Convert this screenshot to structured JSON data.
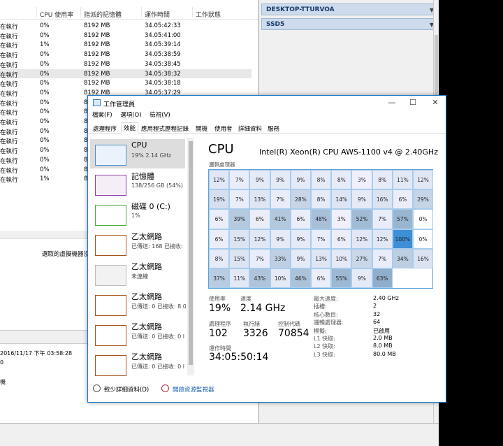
{
  "bg_window": {
    "columns": [
      "CPU 使用率",
      "指派的記憶體",
      "運作時間",
      "工作狀態"
    ],
    "rows": [
      {
        "status": "在執行",
        "cpu": "0%",
        "mem": "8192 MB",
        "uptime": "34.05:42:33"
      },
      {
        "status": "在執行",
        "cpu": "0%",
        "mem": "8192 MB",
        "uptime": "34.05:41:00"
      },
      {
        "status": "在執行",
        "cpu": "1%",
        "mem": "8192 MB",
        "uptime": "34.05:39:14"
      },
      {
        "status": "在執行",
        "cpu": "0%",
        "mem": "8192 MB",
        "uptime": "34.05:38:59"
      },
      {
        "status": "在執行",
        "cpu": "0%",
        "mem": "8192 MB",
        "uptime": "34.05:38:45"
      },
      {
        "status": "在執行",
        "cpu": "0%",
        "mem": "8192 MB",
        "uptime": "34.05:38:32"
      },
      {
        "status": "在執行",
        "cpu": "0%",
        "mem": "8192 MB",
        "uptime": "34.05:38:18"
      },
      {
        "status": "在執行",
        "cpu": "0%",
        "mem": "8192 MB",
        "uptime": "34.05:37:29"
      },
      {
        "status": "在執行",
        "cpu": "0%",
        "mem": "8192 MB",
        "uptime": ""
      },
      {
        "status": "在執行",
        "cpu": "0%",
        "mem": "8192 MB",
        "uptime": ""
      },
      {
        "status": "在執行",
        "cpu": "0%",
        "mem": "8192 MB",
        "uptime": ""
      },
      {
        "status": "在執行",
        "cpu": "0%",
        "mem": "8192 MB",
        "uptime": ""
      },
      {
        "status": "在執行",
        "cpu": "0%",
        "mem": "8192 MB",
        "uptime": ""
      },
      {
        "status": "在執行",
        "cpu": "0%",
        "mem": "8192 MB",
        "uptime": ""
      },
      {
        "status": "在執行",
        "cpu": "0%",
        "mem": "8192 MB",
        "uptime": ""
      },
      {
        "status": "在執行",
        "cpu": "0%",
        "mem": "8192 MB",
        "uptime": ""
      },
      {
        "status": "在執行",
        "cpu": "1%",
        "mem": "8192 MB",
        "uptime": ""
      }
    ],
    "mid_text": "選取的虛擬機器沒",
    "detail_date": "2016/11/17 下午 03:58:28",
    "detail_line2": "0",
    "detail_line3": "機"
  },
  "right_panel": {
    "bar1": "DESKTOP-TTURVOA",
    "bar2": "SSD5",
    "arrow": "▼"
  },
  "tm": {
    "title": "工作管理員",
    "controls": {
      "min": "—",
      "max": "☐",
      "close": "✕"
    },
    "menu": [
      "檔案(F)",
      "選項(O)",
      "檢視(V)"
    ],
    "tabs": [
      "處理程序",
      "效能",
      "應用程式歷程記錄",
      "開機",
      "使用者",
      "詳細資料",
      "服務"
    ],
    "active_tab": "效能",
    "left_items": [
      {
        "name": "CPU",
        "sub": "19% 2.14 GHz",
        "color": "#4a90c8",
        "fill": "#eaf3fb"
      },
      {
        "name": "記憶體",
        "sub": "138/256 GB (54%)",
        "color": "#8e3fa6",
        "fill": "#f5eef8"
      },
      {
        "name": "磁碟 0 (C:)",
        "sub": "1%",
        "color": "#4aaa3c",
        "fill": "#fff"
      },
      {
        "name": "乙太網路",
        "sub": "已傳送: 168 已接收:",
        "color": "#a7521c",
        "fill": "#fff"
      },
      {
        "name": "乙太網路",
        "sub": "未連線",
        "color": "#bbbbbb",
        "fill": "#f2f2f2"
      },
      {
        "name": "乙太網路",
        "sub": "已傳送: 0 已接收: 8.0",
        "color": "#a7521c",
        "fill": "#fff"
      },
      {
        "name": "乙太網路",
        "sub": "已傳送: 0 已接收: 0 l",
        "color": "#a7521c",
        "fill": "#fff"
      },
      {
        "name": "乙太網路",
        "sub": "已傳送: 0 已接收: 0 l",
        "color": "#a7521c",
        "fill": "#fff"
      }
    ],
    "cpu_heading": "CPU",
    "cpu_model": "Intel(R) Xeon(R) CPU AWS-1100 v4 @ 2.40GHz",
    "grid_label": "邏輯處理器",
    "grid": [
      [
        "12%",
        "7%",
        "9%",
        "9%",
        "9%",
        "8%",
        "8%",
        "3%",
        "8%",
        "11%",
        "12%"
      ],
      [
        "19%",
        "7%",
        "13%",
        "7%",
        "28%",
        "8%",
        "14%",
        "9%",
        "16%",
        "6%",
        "29%"
      ],
      [
        "6%",
        "39%",
        "6%",
        "41%",
        "6%",
        "48%",
        "3%",
        "52%",
        "7%",
        "57%",
        "0%"
      ],
      [
        "6%",
        "15%",
        "12%",
        "9%",
        "9%",
        "7%",
        "6%",
        "12%",
        "12%",
        "100%",
        "0%"
      ],
      [
        "8%",
        "15%",
        "7%",
        "33%",
        "9%",
        "13%",
        "10%",
        "27%",
        "7%",
        "34%",
        "16%"
      ],
      [
        "37%",
        "11%",
        "43%",
        "10%",
        "46%",
        "6%",
        "55%",
        "9%",
        "63%",
        "",
        ""
      ]
    ],
    "stats": {
      "usage_label": "使用率",
      "usage": "19%",
      "speed_label": "速度",
      "speed": "2.14 GHz",
      "proc_label": "處理程序",
      "proc": "102",
      "threads_label": "執行緒",
      "threads": "3326",
      "handles_label": "控制代碼",
      "handles": "70854",
      "uptime_label": "運作時間",
      "uptime": "34:05:50:14"
    },
    "info": [
      {
        "label": "最大速度:",
        "value": "2.40 GHz"
      },
      {
        "label": "插槽:",
        "value": "2"
      },
      {
        "label": "核心數目:",
        "value": "32"
      },
      {
        "label": "邏輯處理器:",
        "value": "64"
      },
      {
        "label": "模擬:",
        "value": "已啟用"
      },
      {
        "label": "L1 快取:",
        "value": "2.0 MB"
      },
      {
        "label": "L2 快取:",
        "value": "8.0 MB"
      },
      {
        "label": "L3 快取:",
        "value": "80.0 MB"
      }
    ],
    "footer_less": "較少詳細資料(D)",
    "footer_link": "開啟資源監視器"
  }
}
